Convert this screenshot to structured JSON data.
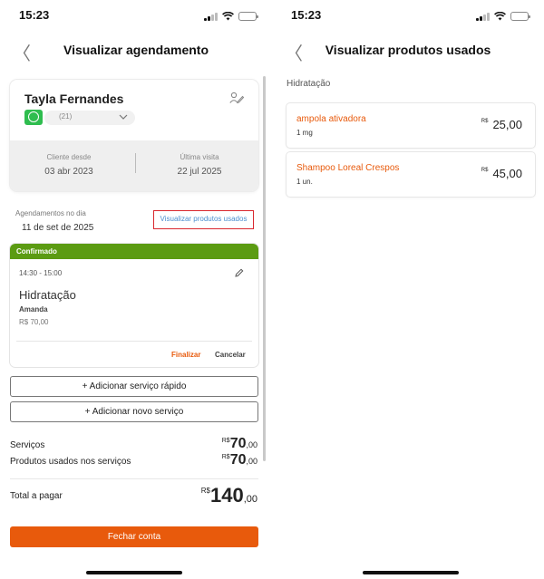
{
  "left": {
    "status_time": "15:23",
    "title": "Visualizar agendamento",
    "back_icon": "chevron-left-icon",
    "client": {
      "name": "Tayla Fernandes",
      "phone": "(21)",
      "since_label": "Cliente desde",
      "since_value": "03 abr 2023",
      "last_visit_label": "Última visita",
      "last_visit_value": "22 jul 2025"
    },
    "agenda": {
      "label": "Agendamentos no dia",
      "date": "11 de set de 2025",
      "link": "Visualizar produtos usados"
    },
    "appointment": {
      "status": "Confirmado",
      "status_color": "#5b9b12",
      "time": "14:30 - 15:00",
      "service": "Hidratação",
      "professional": "Amanda",
      "price": "R$ 70,00",
      "finalize": "Finalizar",
      "cancel": "Cancelar"
    },
    "buttons": {
      "quick_service": "+ Adicionar serviço rápido",
      "new_service": "+ Adicionar novo serviço"
    },
    "summary": {
      "services_label": "Serviços",
      "services_currency": "R$",
      "services_int": "70",
      "services_dec": ",00",
      "products_label": "Produtos usados nos serviços",
      "products_currency": "R$",
      "products_int": "70",
      "products_dec": ",00",
      "total_label": "Total a pagar",
      "total_currency": "R$",
      "total_int": "140",
      "total_dec": ",00"
    },
    "cta": "Fechar conta",
    "accent_color": "#e85a0c"
  },
  "right": {
    "status_time": "15:23",
    "title": "Visualizar produtos usados",
    "back_icon": "chevron-left-icon",
    "category": "Hidratação",
    "products": [
      {
        "name": "ampola ativadora",
        "qty": "1 mg",
        "currency": "R$",
        "price": "25,00"
      },
      {
        "name": "Shampoo Loreal Crespos",
        "qty": "1 un.",
        "currency": "R$",
        "price": "45,00"
      }
    ]
  }
}
